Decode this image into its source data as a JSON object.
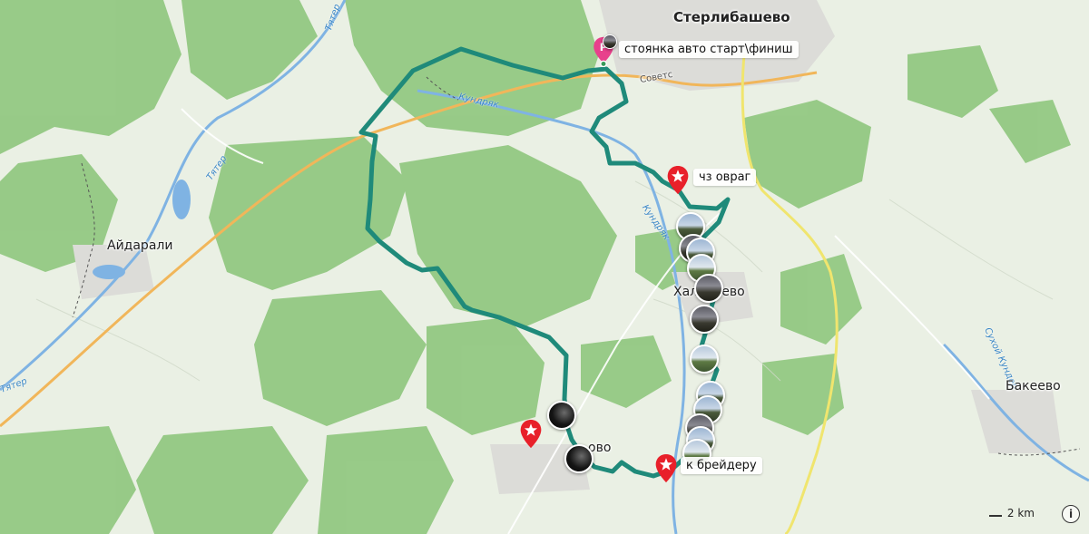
{
  "map": {
    "towns": {
      "sterlibashevo": "Стерлибашево",
      "aidarali": "Айдарали",
      "khalikeevo": "Халикеево",
      "bakeevo": "Бакеево",
      "bottom_village": "ово"
    },
    "rivers": {
      "kundryak_upper": "Кундряк",
      "kundryak_lower": "Кундряк",
      "tatyr_top": "Тятер",
      "tatyr_mid": "Тятер",
      "tatyr_left": "Тятер",
      "sukhoy_kunder": "Сухой Кундер"
    },
    "street": "Советс",
    "pois": {
      "parking": "стоянка авто старт\\финиш",
      "ravine": "чз овраг",
      "ford": "к брейдеру"
    },
    "parking_letter": "P",
    "scale_label": "2 km",
    "info_symbol": "i",
    "colors": {
      "route": "#1f8a7a",
      "forest": "#8cc47a",
      "water": "#7fb3e3",
      "marker": "#e8202a",
      "parking": "#e8418c",
      "road_major": "#f5c36a",
      "road_yellow": "#f2ea7a"
    }
  }
}
